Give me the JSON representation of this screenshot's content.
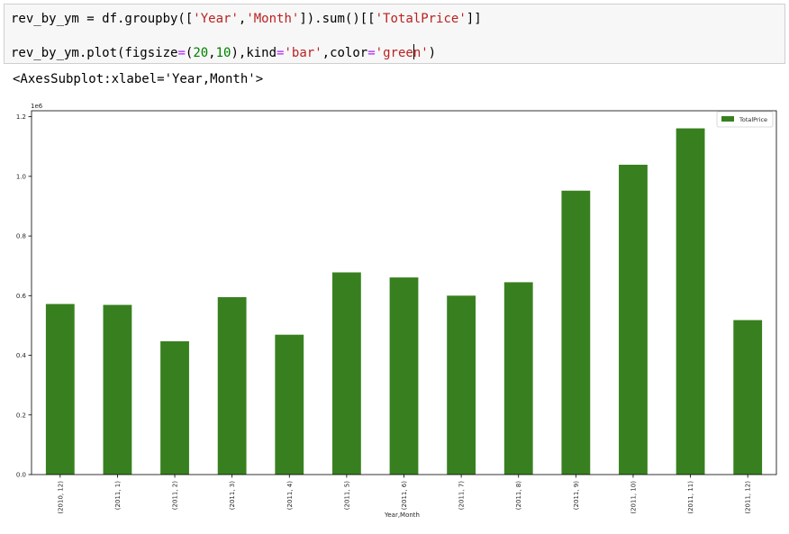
{
  "code": {
    "line1": {
      "prefix": "rev_by_ym = df.groupby([",
      "s1": "'Year'",
      "comma1": ",",
      "s2": "'Month'",
      "mid": "]).sum()[[",
      "s3": "'TotalPrice'",
      "suffix": "]]"
    },
    "line2": {
      "prefix": "rev_by_ym.plot(figsize",
      "eq1": "=",
      "p1": "(",
      "n1": "20",
      "comma": ",",
      "n2": "10",
      "mid": "),kind",
      "eq2": "=",
      "s1": "'bar'",
      "mid2": ",color",
      "eq3": "=",
      "s2a": "'gree",
      "s2b": "n'",
      "suffix": ")"
    }
  },
  "output": {
    "repr": "<AxesSubplot:xlabel='Year,Month'>"
  },
  "colors": {
    "bar": "#38801f",
    "axis": "#000000",
    "text": "#262626"
  },
  "chart_data": {
    "type": "bar",
    "categories": [
      "(2010, 12)",
      "(2011, 1)",
      "(2011, 2)",
      "(2011, 3)",
      "(2011, 4)",
      "(2011, 5)",
      "(2011, 6)",
      "(2011, 7)",
      "(2011, 8)",
      "(2011, 9)",
      "(2011, 10)",
      "(2011, 11)",
      "(2011, 12)"
    ],
    "series": [
      {
        "name": "TotalPrice",
        "values": [
          572000,
          569000,
          447000,
          595000,
          469000,
          678000,
          661000,
          600000,
          645000,
          952000,
          1039000,
          1161000,
          518000
        ]
      }
    ],
    "xlabel": "Year,Month",
    "ylabel": "",
    "ylim": [
      0,
      1220000
    ],
    "yticks": [
      "0.0",
      "0.2",
      "0.4",
      "0.6",
      "0.8",
      "1.0",
      "1.2"
    ],
    "ytick_values": [
      0,
      200000,
      400000,
      600000,
      800000,
      1000000,
      1200000
    ],
    "offset_text": "1e6",
    "legend_position": "top-right",
    "grid": false
  }
}
